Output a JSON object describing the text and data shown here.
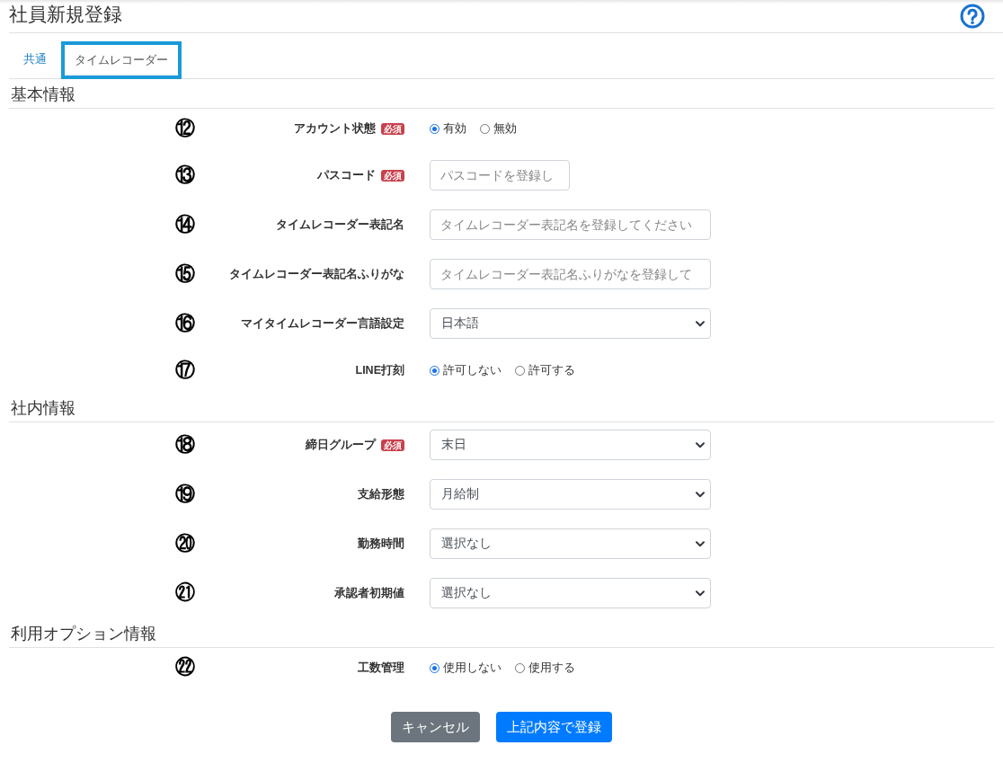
{
  "header": {
    "title": "社員新規登録"
  },
  "tabs": [
    {
      "label": "共通",
      "selected": false
    },
    {
      "label": "タイムレコーダー",
      "selected": true
    }
  ],
  "sections": [
    {
      "title": "基本情報",
      "rows": [
        {
          "marker": "⑫",
          "label": "アカウント状態",
          "badge": "必須",
          "kind": "radio",
          "options": [
            {
              "label": "有効",
              "selected": true
            },
            {
              "label": "無効",
              "selected": false
            }
          ]
        },
        {
          "marker": "⑬",
          "label": "パスコード",
          "badge": "必須",
          "kind": "shortinput",
          "placeholder": "パスコードを登録し"
        },
        {
          "marker": "⑭",
          "label": "タイムレコーダー表記名",
          "kind": "input",
          "placeholder": "タイムレコーダー表記名を登録してください"
        },
        {
          "marker": "⑮",
          "label": "タイムレコーダー表記名ふりがな",
          "kind": "input",
          "placeholder": "タイムレコーダー表記名ふりがなを登録して"
        },
        {
          "marker": "⑯",
          "label": "マイタイムレコーダー言語設定",
          "kind": "select",
          "value": "日本語"
        },
        {
          "marker": "⑰",
          "label": "LINE打刻",
          "kind": "radio",
          "options": [
            {
              "label": "許可しない",
              "selected": true
            },
            {
              "label": "許可する",
              "selected": false
            }
          ]
        }
      ]
    },
    {
      "title": "社内情報",
      "rows": [
        {
          "marker": "⑱",
          "label": "締日グループ",
          "badge": "必須",
          "kind": "select",
          "value": "末日"
        },
        {
          "marker": "⑲",
          "label": "支給形態",
          "kind": "select",
          "value": "月給制"
        },
        {
          "marker": "⑳",
          "label": "勤務時間",
          "kind": "select",
          "value": "選択なし"
        },
        {
          "marker": "㉑",
          "label": "承認者初期値",
          "kind": "select",
          "value": "選択なし"
        }
      ]
    },
    {
      "title": "利用オプション情報",
      "rows": [
        {
          "marker": "㉒",
          "label": "工数管理",
          "kind": "radio",
          "options": [
            {
              "label": "使用しない",
              "selected": true
            },
            {
              "label": "使用する",
              "selected": false
            }
          ]
        }
      ]
    }
  ],
  "buttons": [
    {
      "label": "キャンセル",
      "kind": "secondary"
    },
    {
      "label": "上記内容で登録",
      "kind": "primary"
    }
  ]
}
